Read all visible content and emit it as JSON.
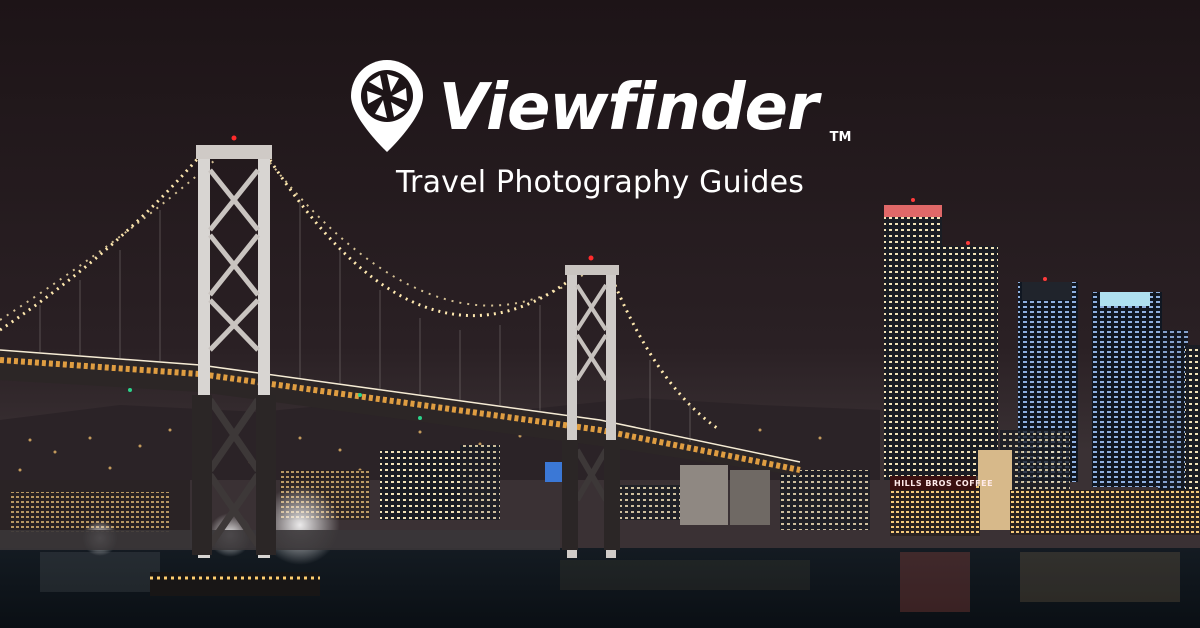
{
  "brand": {
    "name": "Viewfinder",
    "trademark": "TM",
    "tagline": "Travel Photography Guides"
  },
  "scene": {
    "signs": [
      "HILLS BROS COFFEE"
    ],
    "colors": {
      "sky": "#1c1418",
      "water": "#0b1218",
      "bridge_lights": "#ffe9b0",
      "brand_text": "#ffffff"
    }
  }
}
